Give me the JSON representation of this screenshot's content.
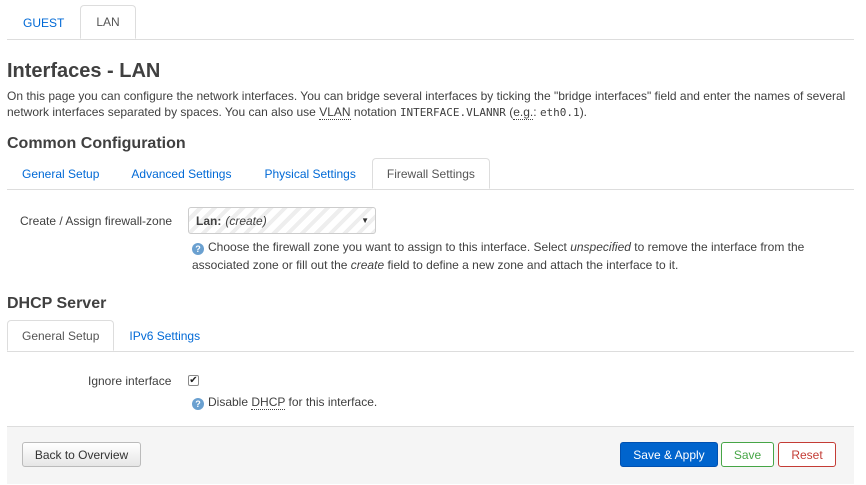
{
  "top_tabs": [
    {
      "label": "GUEST",
      "active": false
    },
    {
      "label": "LAN",
      "active": true
    }
  ],
  "page": {
    "title": "Interfaces - LAN",
    "description_part1": "On this page you can configure the network interfaces. You can bridge several interfaces by ticking the \"bridge interfaces\" field and enter the names of several network interfaces separated by spaces. You can also use ",
    "vlan_abbr": "VLAN",
    "description_part2": " notation ",
    "notation_code": "INTERFACE.VLANNR",
    "description_part3": " (",
    "eg_abbr": "e.g.",
    "description_part4": ": ",
    "example_code": "eth0.1",
    "description_part5": ")."
  },
  "common_config": {
    "heading": "Common Configuration",
    "tabs": [
      {
        "label": "General Setup",
        "active": false
      },
      {
        "label": "Advanced Settings",
        "active": false
      },
      {
        "label": "Physical Settings",
        "active": false
      },
      {
        "label": "Firewall Settings",
        "active": true
      }
    ],
    "firewall_zone": {
      "label": "Create / Assign firewall-zone",
      "selected_bold": "Lan:",
      "selected_italic": "(create)",
      "help_part1": "Choose the firewall zone you want to assign to this interface. Select ",
      "help_unspecified": "unspecified",
      "help_part2": " to remove the interface from the associated zone or fill out the ",
      "help_create": "create",
      "help_part3": " field to define a new zone and attach the interface to it."
    }
  },
  "dhcp_server": {
    "heading": "DHCP Server",
    "tabs": [
      {
        "label": "General Setup",
        "active": true
      },
      {
        "label": "IPv6 Settings",
        "active": false
      }
    ],
    "ignore_interface": {
      "label": "Ignore interface",
      "checked": true,
      "help_part1": "Disable ",
      "help_abbr": "DHCP",
      "help_part2": " for this interface."
    }
  },
  "footer": {
    "back_label": "Back to Overview",
    "save_apply_label": "Save & Apply",
    "save_label": "Save",
    "reset_label": "Reset"
  },
  "colors": {
    "link": "#0069d6",
    "primary": "#0064cd",
    "success": "#46a546",
    "danger": "#c43c35"
  }
}
